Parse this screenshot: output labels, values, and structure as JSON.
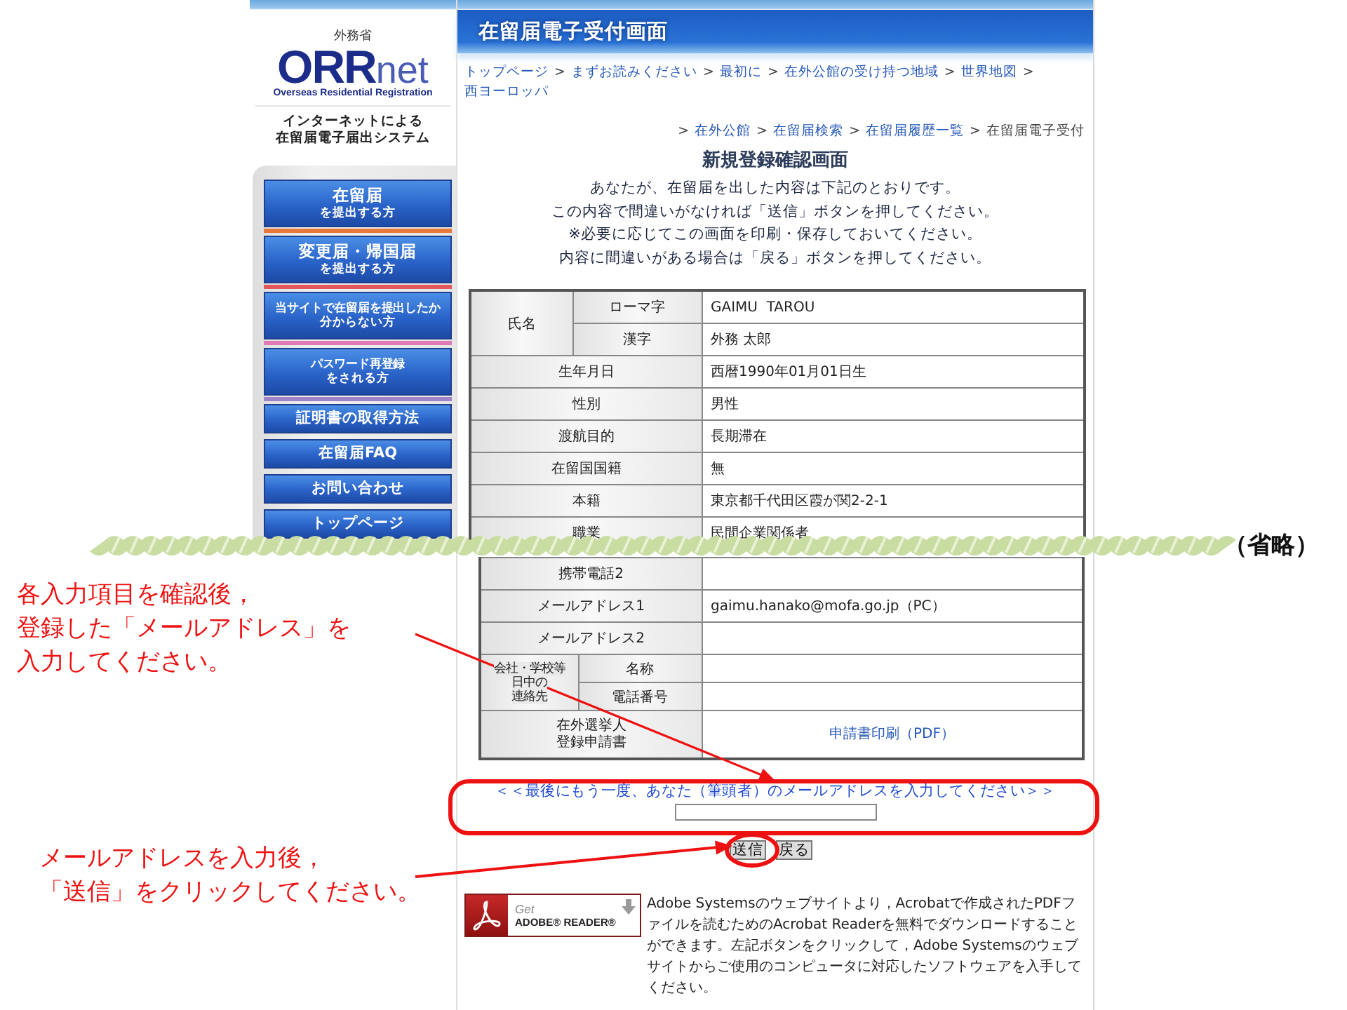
{
  "logo": {
    "ministry": "外務省",
    "brand_main": "ORR",
    "brand_sub": "net",
    "tagline": "Overseas Residential Registration",
    "system_name": [
      "インターネットによる",
      "在留届電子届出システム"
    ]
  },
  "sidebar": {
    "items": [
      {
        "kind": "tall",
        "lines": [
          "在留届",
          "を提出する方"
        ],
        "color": "#e8773a"
      },
      {
        "kind": "tall",
        "lines": [
          "変更届・帰国届",
          "を提出する方"
        ],
        "color": "#e2575c"
      },
      {
        "kind": "even",
        "lines": [
          "当サイトで在留届を提出したか",
          "分からない方"
        ],
        "color": "#e07ab5"
      },
      {
        "kind": "even",
        "lines": [
          "パスワード再登録",
          "をされる方"
        ],
        "color": "#9f82c8"
      },
      {
        "kind": "short",
        "lines": [
          "証明書の取得方法"
        ]
      },
      {
        "kind": "short",
        "lines": [
          "在留届FAQ"
        ]
      },
      {
        "kind": "short",
        "lines": [
          "お問い合わせ"
        ]
      },
      {
        "kind": "short",
        "lines": [
          "トップページ"
        ]
      }
    ]
  },
  "header": {
    "title": "在留届電子受付画面"
  },
  "breadcrumb": {
    "lines": [
      [
        {
          "kind": "link",
          "text": "トップページ"
        },
        {
          "kind": "sep",
          "text": ">"
        },
        {
          "kind": "link",
          "text": "まずお読みください"
        },
        {
          "kind": "sep",
          "text": ">"
        },
        {
          "kind": "link",
          "text": "最初に"
        },
        {
          "kind": "sep",
          "text": ">"
        },
        {
          "kind": "link",
          "text": "在外公館の受け持つ地域"
        },
        {
          "kind": "sep",
          "text": ">"
        },
        {
          "kind": "link",
          "text": "世界地図"
        },
        {
          "kind": "sep",
          "text": ">"
        },
        {
          "kind": "link",
          "text": "西ヨーロッパ"
        }
      ],
      [
        {
          "kind": "sep",
          "text": ">"
        },
        {
          "kind": "link",
          "text": "在外公館"
        },
        {
          "kind": "sep",
          "text": ">"
        },
        {
          "kind": "link",
          "text": "在留届検索"
        },
        {
          "kind": "sep",
          "text": ">"
        },
        {
          "kind": "link",
          "text": "在留届履歴一覧"
        },
        {
          "kind": "sep",
          "text": ">"
        },
        {
          "kind": "current",
          "text": "在留届電子受付"
        }
      ]
    ]
  },
  "title": "新規登録確認画面",
  "intro": [
    "あなたが、在留届を出した内容は下記のとおりです。",
    "この内容で間違いがなければ「送信」ボタンを押してください。",
    "※必要に応じてこの画面を印刷・保存しておいてください。",
    "内容に間違いがある場合は「戻る」ボタンを押してください。"
  ],
  "table_top": {
    "rows": [
      {
        "kind": "group",
        "label": "氏名",
        "parts": [
          {
            "label": "ローマ字",
            "value": "GAIMU  TAROU"
          },
          {
            "label": "漢字",
            "value": "外務 太郎"
          }
        ]
      },
      {
        "kind": "single",
        "label": "生年月日",
        "value": "西暦1990年01月01日生"
      },
      {
        "kind": "single",
        "label": "性別",
        "value": "男性"
      },
      {
        "kind": "single",
        "label": "渡航目的",
        "value": "長期滞在"
      },
      {
        "kind": "single",
        "label": "在留国国籍",
        "value": "無"
      },
      {
        "kind": "single",
        "label": "本籍",
        "value": "東京都千代田区霞が関2-2-1"
      },
      {
        "kind": "single",
        "label": "職業",
        "value": "民間企業関係者"
      }
    ]
  },
  "omission_note": "（省略）",
  "table_bottom": {
    "rows": [
      {
        "kind": "single",
        "label": "携帯電話2"
      },
      {
        "kind": "single",
        "label": "メールアドレス1",
        "value": "gaimu.hanako@mofa.go.jp（PC）"
      },
      {
        "kind": "single",
        "label": "メールアドレス2"
      },
      {
        "kind": "group",
        "label_lines": [
          "会社・学校等",
          "日中の",
          "連絡先"
        ],
        "parts": [
          {
            "label": "名称"
          },
          {
            "label": "電話番号"
          }
        ]
      },
      {
        "kind": "link",
        "label_lines": [
          "在外選挙人",
          "登録申請書"
        ],
        "value": "申請書印刷（PDF）"
      }
    ]
  },
  "email_prompt": "＜＜最後にもう一度、あなた（筆頭者）のメールアドレスを入力してください＞＞",
  "buttons": [
    "送信",
    "戻る"
  ],
  "adobe": {
    "badge_get": "Get",
    "badge_name": "ADOBE® READER®",
    "text": "Adobe Systemsのウェブサイトより，Acrobatで作成されたPDFファイルを読むためのAcrobat Readerを無料でダウンロードすることができます。左記ボタンをクリックして，Adobe Systemsのウェブサイトからご使用のコンピュータに対応したソフトウェアを入手してください。"
  },
  "annotations": [
    {
      "lines": [
        "各入力項目を確認後，",
        "登録した「メールアドレス」を",
        "入力してください。"
      ]
    },
    {
      "lines": [
        "メールアドレスを入力後，",
        "「送信」をクリックしてください。"
      ]
    }
  ]
}
